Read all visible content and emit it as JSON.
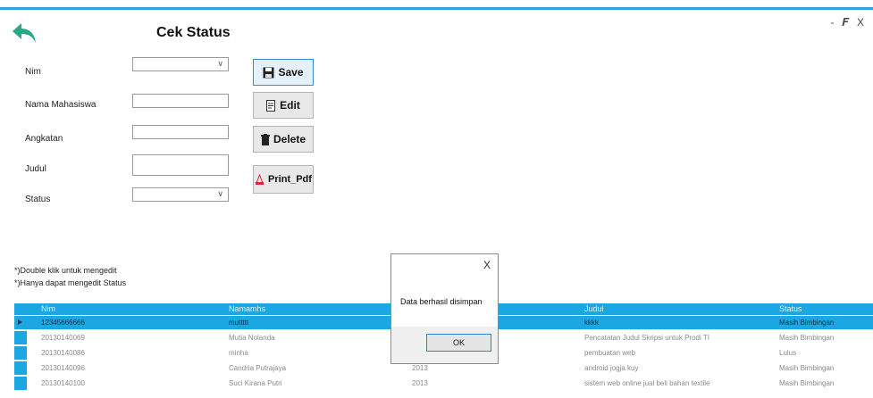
{
  "window": {
    "minimize": "-",
    "maximize": "Æ’",
    "close": "X"
  },
  "form": {
    "title": "Cek Status",
    "fields": [
      {
        "label": "Nim",
        "value": ""
      },
      {
        "label": "Nama Mahasiswa",
        "value": ""
      },
      {
        "label": "Angkatan",
        "value": ""
      },
      {
        "label": "Judul",
        "value": ""
      },
      {
        "label": "Status",
        "value": ""
      }
    ],
    "buttons": {
      "save": "Save",
      "edit": "Edit",
      "delete": "Delete",
      "print": "Print_Pdf"
    }
  },
  "notes": [
    "*)Double klik untuk mengedit",
    "*)Hanya dapat mengedit Status"
  ],
  "table": {
    "columns": [
      "Nim",
      "Namamhs",
      "",
      "Judul",
      "Status"
    ],
    "rows": [
      {
        "nim": "12345666666",
        "nama": "muttttt",
        "angkatan": "",
        "judul": "kkkk",
        "status": "Masih Bimbingan"
      },
      {
        "nim": "20130140069",
        "nama": "Mutia Nolanda",
        "angkatan": "",
        "judul": "Pencatatan Judul Skripsi untuk Prodi TI",
        "status": "Masih Bimbingan"
      },
      {
        "nim": "20130140086",
        "nama": "minha",
        "angkatan": "",
        "judul": "pembuatan web",
        "status": "Lulus"
      },
      {
        "nim": "20130140096",
        "nama": "Candria Putrajaya",
        "angkatan": "2013",
        "judul": "android jogja kuy",
        "status": "Masih Bimbingan"
      },
      {
        "nim": "20130140100",
        "nama": "Suci Kirana Putri",
        "angkatan": "2013",
        "judul": "sistem web online jual beli bahan textile",
        "status": "Masih Bimbingan"
      }
    ]
  },
  "dialog": {
    "close": "X",
    "message": "Data berhasil disimpan",
    "ok": "OK"
  },
  "colors": {
    "accent": "#1aa7e2",
    "back_arrow": "#2aa689"
  }
}
